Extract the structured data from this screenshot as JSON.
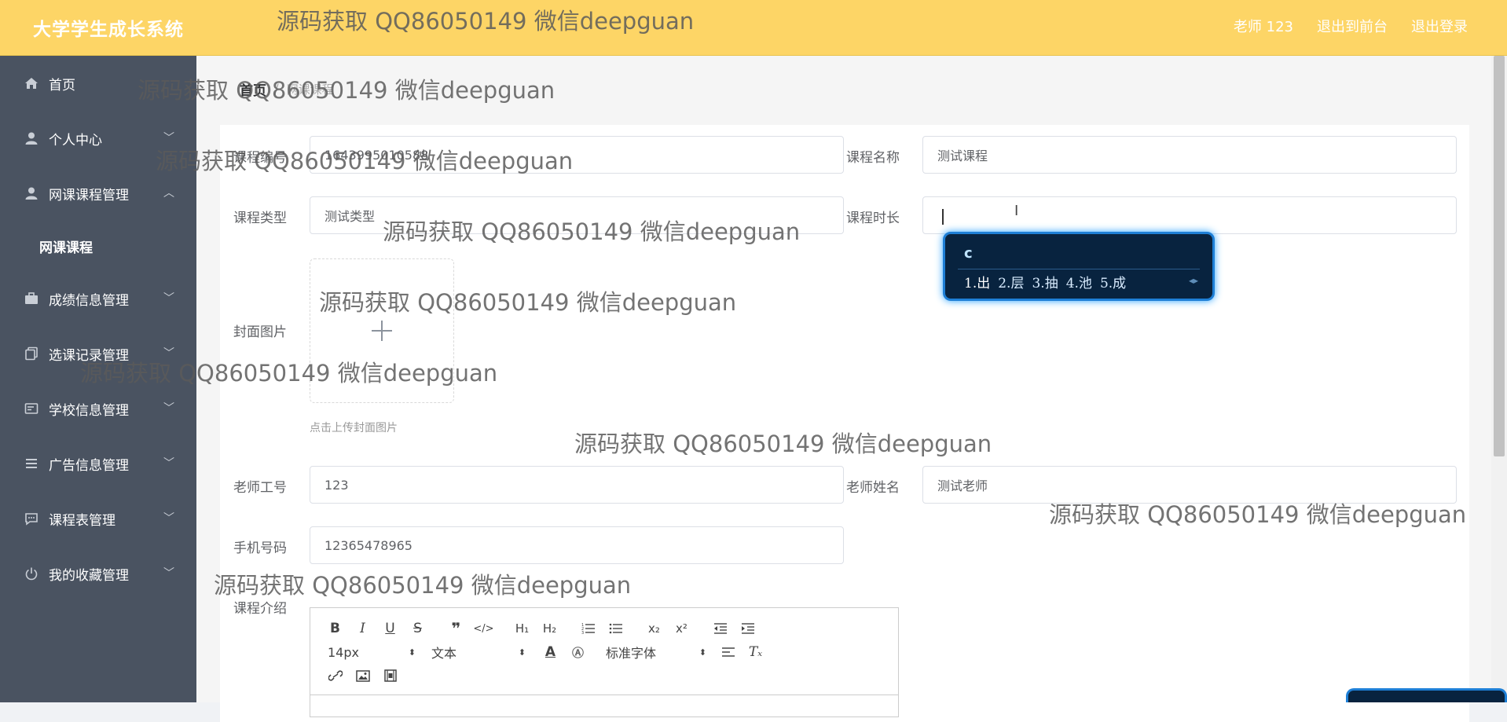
{
  "header": {
    "brand": "大学学生成长系统",
    "user_label": "老师 123",
    "front_link": "退出到前台",
    "logout_link": "退出登录"
  },
  "sidebar": {
    "items": [
      {
        "label": "首页",
        "icon": "home-icon"
      },
      {
        "label": "个人中心",
        "icon": "user-icon"
      },
      {
        "label": "网课课程管理",
        "icon": "user-icon",
        "expanded": true,
        "children": [
          "网课课程"
        ]
      },
      {
        "label": "成绩信息管理",
        "icon": "briefcase-icon"
      },
      {
        "label": "选课记录管理",
        "icon": "copy-icon"
      },
      {
        "label": "学校信息管理",
        "icon": "card-icon"
      },
      {
        "label": "广告信息管理",
        "icon": "list-icon"
      },
      {
        "label": "课程表管理",
        "icon": "chat-icon"
      },
      {
        "label": "我的收藏管理",
        "icon": "power-icon"
      }
    ]
  },
  "breadcrumb": {
    "home": "首页",
    "separator": "/",
    "current": "网课课程"
  },
  "form": {
    "course_no_label": "课程编号",
    "course_no_value": "1643995010588",
    "course_name_label": "课程名称",
    "course_name_value": "测试课程",
    "course_type_label": "课程类型",
    "course_type_value": "测试类型",
    "duration_label": "课程时长",
    "duration_value": "",
    "cover_label": "封面图片",
    "upload_hint": "点击上传封面图片",
    "teacher_no_label": "老师工号",
    "teacher_no_value": "123",
    "teacher_name_label": "老师姓名",
    "teacher_name_value": "测试老师",
    "phone_label": "手机号码",
    "phone_value": "12365478965",
    "intro_label": "课程介绍"
  },
  "editor": {
    "font_size": "14px",
    "paragraph": "文本",
    "font_family": "标准字体"
  },
  "ime": {
    "input": "c",
    "candidates": [
      "1.出",
      "2.层",
      "3.抽",
      "4.池",
      "5.成"
    ]
  },
  "watermark": "源码获取 QQ86050149 微信deepguan",
  "colors": {
    "header_bg": "#fdd566",
    "sidebar_bg": "#4a5361",
    "ime_bg": "#08233f",
    "ime_border": "#1e7fd6"
  }
}
